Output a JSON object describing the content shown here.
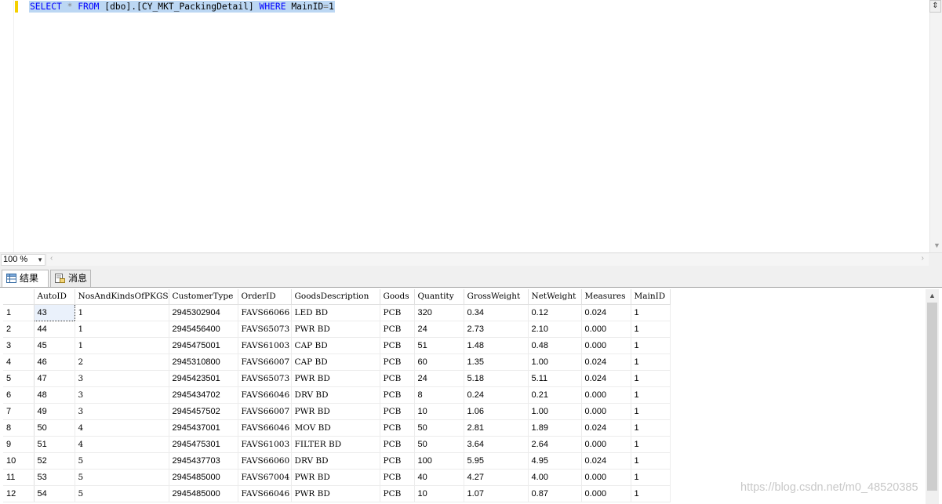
{
  "editor": {
    "sql_kw_select": "SELECT",
    "sql_star": "*",
    "sql_kw_from": "FROM",
    "sql_table": "[dbo].[CY_MKT_PackingDetail]",
    "sql_kw_where": "WHERE",
    "sql_cond": "MainID",
    "sql_eq": "=",
    "sql_val": "1"
  },
  "zoom": {
    "value": "100 %"
  },
  "tabs": [
    {
      "label": "结果",
      "icon": "grid-icon"
    },
    {
      "label": "消息",
      "icon": "messages-icon"
    }
  ],
  "grid": {
    "columns": [
      "AutoID",
      "NosAndKindsOfPKGS",
      "CustomerType",
      "OrderID",
      "GoodsDescription",
      "Goods",
      "Quantity",
      "GrossWeight",
      "NetWeight",
      "Measures",
      "MainID"
    ],
    "rows": [
      [
        "1",
        "43",
        "1",
        "2945302904",
        "FAVS66066",
        "LED BD",
        "PCB",
        "320",
        "0.34",
        "0.12",
        "0.024",
        "1"
      ],
      [
        "2",
        "44",
        "1",
        "2945456400",
        "FAVS65073",
        "PWR BD",
        "PCB",
        "24",
        "2.73",
        "2.10",
        "0.000",
        "1"
      ],
      [
        "3",
        "45",
        "1",
        "2945475001",
        "FAVS61003",
        "CAP BD",
        "PCB",
        "51",
        "1.48",
        "0.48",
        "0.000",
        "1"
      ],
      [
        "4",
        "46",
        "2",
        "2945310800",
        "FAVS66007",
        "CAP BD",
        "PCB",
        "60",
        "1.35",
        "1.00",
        "0.024",
        "1"
      ],
      [
        "5",
        "47",
        "3",
        "2945423501",
        "FAVS65073",
        "PWR BD",
        "PCB",
        "24",
        "5.18",
        "5.11",
        "0.024",
        "1"
      ],
      [
        "6",
        "48",
        "3",
        "2945434702",
        "FAVS66046",
        "DRV BD",
        "PCB",
        "8",
        "0.24",
        "0.21",
        "0.000",
        "1"
      ],
      [
        "7",
        "49",
        "3",
        "2945457502",
        "FAVS66007",
        "PWR BD",
        "PCB",
        "10",
        "1.06",
        "1.00",
        "0.000",
        "1"
      ],
      [
        "8",
        "50",
        "4",
        "2945437001",
        "FAVS66046",
        "MOV BD",
        "PCB",
        "50",
        "2.81",
        "1.89",
        "0.024",
        "1"
      ],
      [
        "9",
        "51",
        "4",
        "2945475301",
        "FAVS61003",
        "FILTER BD",
        "PCB",
        "50",
        "3.64",
        "2.64",
        "0.000",
        "1"
      ],
      [
        "10",
        "52",
        "5",
        "2945437703",
        "FAVS66060",
        "DRV BD",
        "PCB",
        "100",
        "5.95",
        "4.95",
        "0.024",
        "1"
      ],
      [
        "11",
        "53",
        "5",
        "2945485000",
        "FAVS67004",
        "PWR BD",
        "PCB",
        "40",
        "4.27",
        "4.00",
        "0.000",
        "1"
      ],
      [
        "12",
        "54",
        "5",
        "2945485000",
        "FAVS66046",
        "PWR BD",
        "PCB",
        "10",
        "1.07",
        "0.87",
        "0.000",
        "1"
      ]
    ]
  },
  "watermark": "https://blog.csdn.net/m0_48520385"
}
